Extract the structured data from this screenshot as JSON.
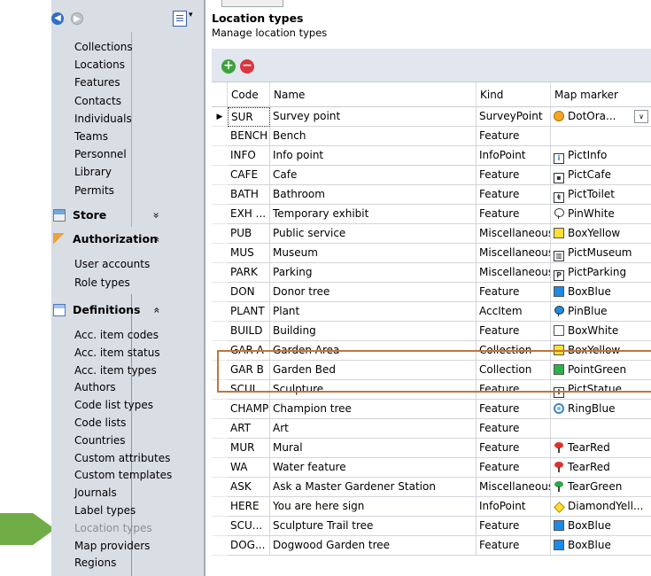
{
  "nav": {
    "items_top": [
      "Collections",
      "Locations",
      "Features",
      "Contacts",
      "Individuals",
      "Teams",
      "Personnel",
      "Library",
      "Permits"
    ],
    "sections": {
      "store": "Store",
      "authorization": "Authorization",
      "definitions": "Definitions"
    },
    "chevron_collapsed": "»",
    "chevron_expanded": "»",
    "auth_items": [
      "User accounts",
      "Role types"
    ],
    "def_items": [
      "Acc. item codes",
      "Acc. item status",
      "Acc. item types",
      "Authors",
      "Code list types",
      "Code lists",
      "Countries",
      "Custom attributes",
      "Custom templates",
      "Journals",
      "Label types",
      "Location types",
      "Map providers",
      "Regions"
    ],
    "active_item": "Location types",
    "nav_arrow_color": "#70ad47"
  },
  "header": {
    "title": "Location types",
    "subtitle": "Manage location types"
  },
  "toolbar": {
    "add": "+",
    "remove": "−"
  },
  "grid": {
    "columns": [
      "Code",
      "Name",
      "Kind",
      "Map marker"
    ],
    "rows": [
      {
        "code": "SUR",
        "name": "Survey point",
        "kind": "SurveyPoint",
        "marker": "DotOra...",
        "icon": "dot",
        "color": "#f5a623"
      },
      {
        "code": "BENCH",
        "name": "Bench",
        "kind": "Feature",
        "marker": "",
        "icon": "",
        "color": ""
      },
      {
        "code": "INFO",
        "name": "Info point",
        "kind": "InfoPoint",
        "marker": "PictInfo",
        "icon": "pict",
        "glyph": "i",
        "color": "#2f6fc8"
      },
      {
        "code": "CAFE",
        "name": "Cafe",
        "kind": "Feature",
        "marker": "PictCafe",
        "icon": "pict",
        "glyph": "▪",
        "color": "#333"
      },
      {
        "code": "BATH",
        "name": "Bathroom",
        "kind": "Feature",
        "marker": "PictToilet",
        "icon": "pict",
        "glyph": "ŧ",
        "color": "#333"
      },
      {
        "code": "EXH ...",
        "name": "Temporary exhibit",
        "kind": "Feature",
        "marker": "PinWhite",
        "icon": "pin",
        "color": "#ffffff"
      },
      {
        "code": "PUB",
        "name": "Public service",
        "kind": "Miscellaneous",
        "marker": "BoxYellow",
        "icon": "sq",
        "color": "#ffe033"
      },
      {
        "code": "MUS",
        "name": "Museum",
        "kind": "Miscellaneous",
        "marker": "PictMuseum",
        "icon": "pict",
        "glyph": "▥",
        "color": "#333"
      },
      {
        "code": "PARK",
        "name": "Parking",
        "kind": "Miscellaneous",
        "marker": "PictParking",
        "icon": "pict",
        "glyph": "P",
        "color": "#333"
      },
      {
        "code": "DON",
        "name": "Donor tree",
        "kind": "Feature",
        "marker": "BoxBlue",
        "icon": "sq",
        "color": "#1c8ae6"
      },
      {
        "code": "PLANT",
        "name": "Plant",
        "kind": "AccItem",
        "marker": "PinBlue",
        "icon": "pin",
        "color": "#1c8ae6"
      },
      {
        "code": "BUILD",
        "name": "Building",
        "kind": "Feature",
        "marker": "BoxWhite",
        "icon": "sq",
        "color": "#ffffff"
      },
      {
        "code": "GAR A",
        "name": "Garden Area",
        "kind": "Collection",
        "marker": "BoxYellow",
        "icon": "sq",
        "color": "#ffe033"
      },
      {
        "code": "GAR B",
        "name": "Garden Bed",
        "kind": "Collection",
        "marker": "PointGreen",
        "icon": "sq",
        "color": "#27b34a"
      },
      {
        "code": "SCUL",
        "name": "Sculpture",
        "kind": "Feature",
        "marker": "PictStatue",
        "icon": "pict",
        "glyph": "I",
        "color": "#333"
      },
      {
        "code": "CHAMP",
        "name": "Champion tree",
        "kind": "Feature",
        "marker": "RingBlue",
        "icon": "ring",
        "color": "#3d86c8"
      },
      {
        "code": "ART",
        "name": "Art",
        "kind": "Feature",
        "marker": "",
        "icon": "",
        "color": ""
      },
      {
        "code": "MUR",
        "name": "Mural",
        "kind": "Feature",
        "marker": "TearRed",
        "icon": "tear",
        "color": "#e0302e"
      },
      {
        "code": "WA",
        "name": "Water feature",
        "kind": "Feature",
        "marker": "TearRed",
        "icon": "tear",
        "color": "#e0302e"
      },
      {
        "code": "ASK",
        "name": "Ask a Master Gardener Station",
        "kind": "Miscellaneous",
        "marker": "TearGreen",
        "icon": "tear",
        "color": "#2aa84a"
      },
      {
        "code": "HERE",
        "name": "You are here sign",
        "kind": "InfoPoint",
        "marker": "DiamondYell...",
        "icon": "dia",
        "color": "#ffe033"
      },
      {
        "code": "SCU...",
        "name": "Sculpture Trail tree",
        "kind": "Feature",
        "marker": "BoxBlue",
        "icon": "sq",
        "color": "#1c8ae6"
      },
      {
        "code": "DOG...",
        "name": "Dogwood Garden tree",
        "kind": "Feature",
        "marker": "BoxBlue",
        "icon": "sq",
        "color": "#1c8ae6"
      }
    ],
    "highlighted_codes": [
      "GAR A",
      "GAR B"
    ],
    "highlight_color": "#c0763b"
  }
}
